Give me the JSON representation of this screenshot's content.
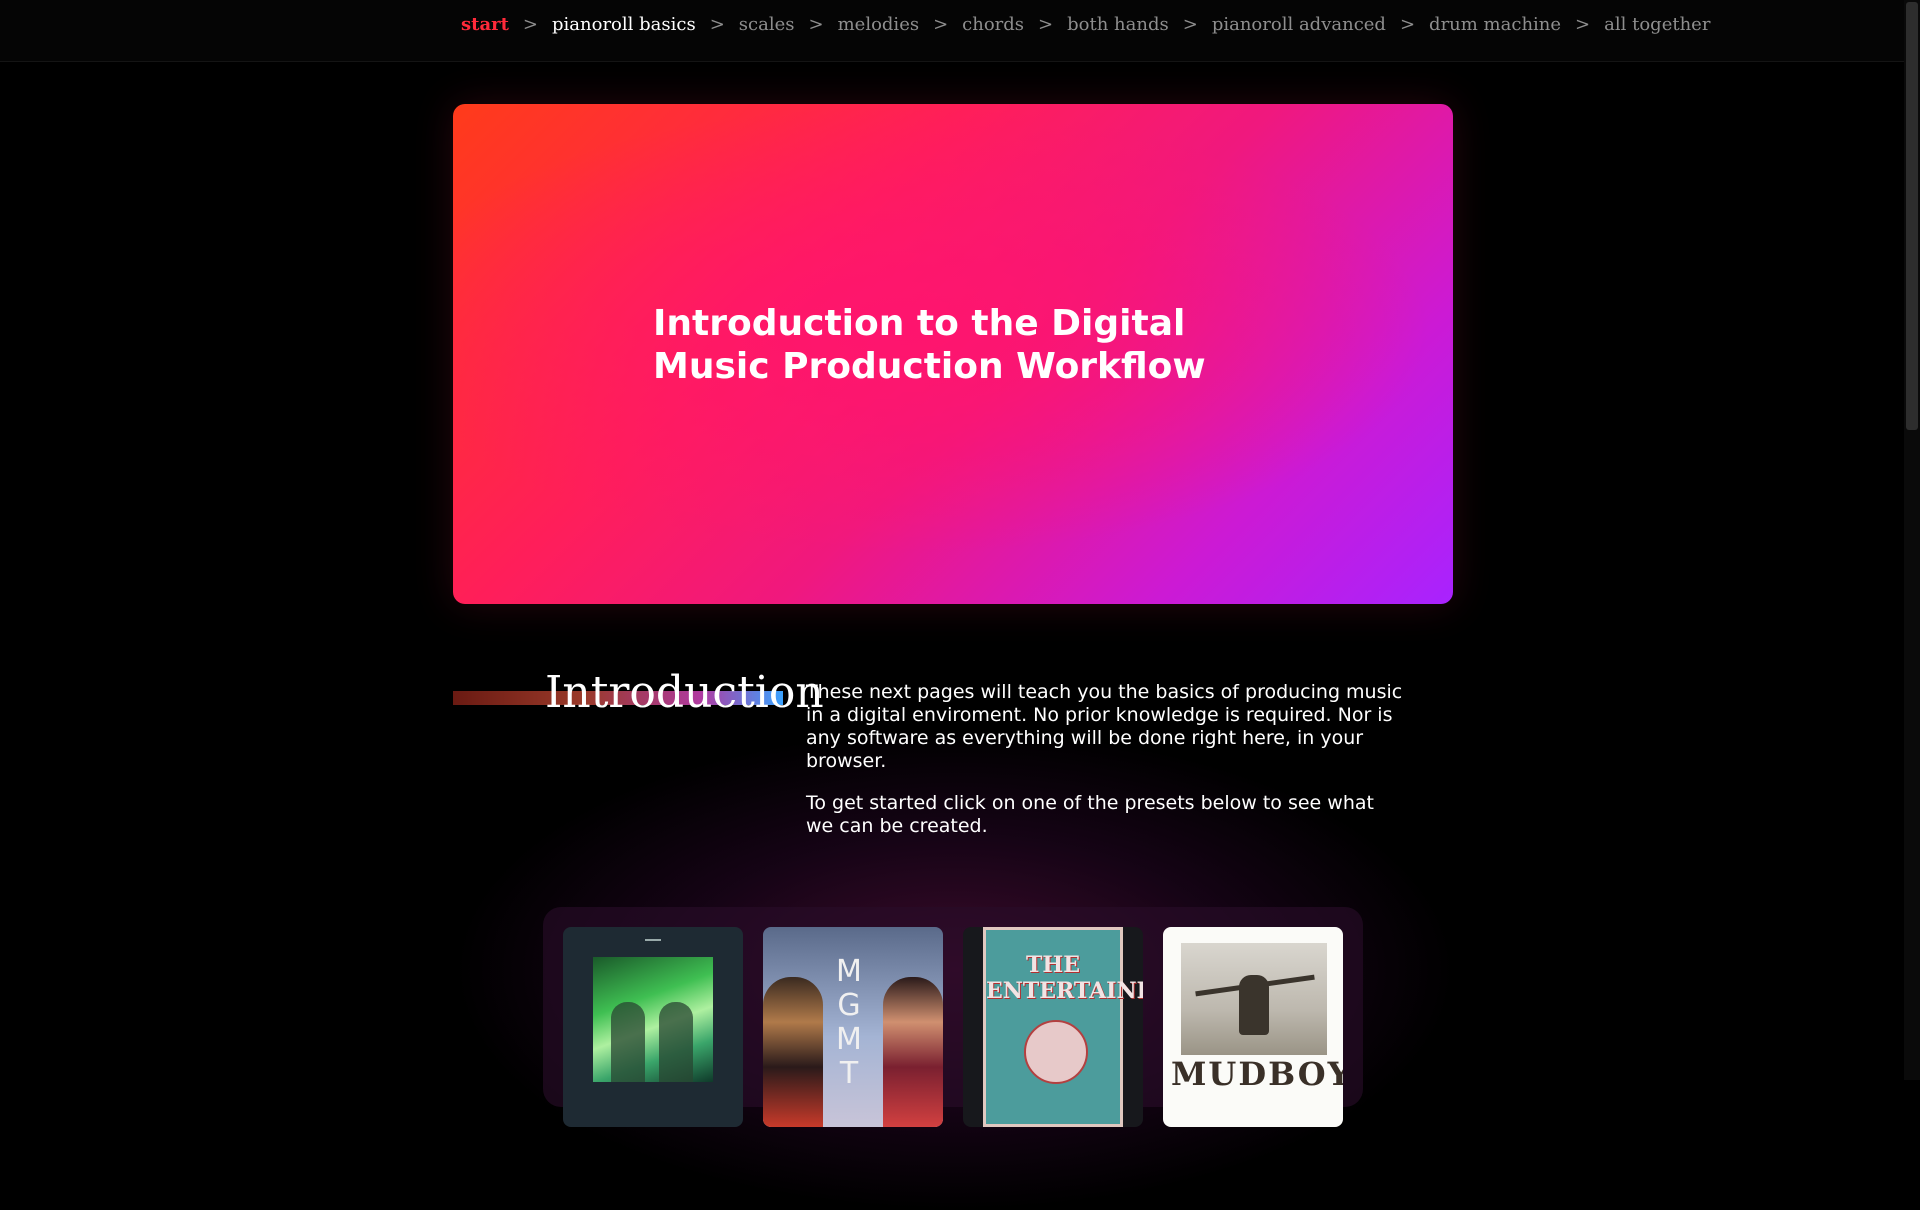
{
  "nav": {
    "items": [
      {
        "label": "start"
      },
      {
        "label": "pianoroll basics"
      },
      {
        "label": "scales"
      },
      {
        "label": "melodies"
      },
      {
        "label": "chords"
      },
      {
        "label": "both hands"
      },
      {
        "label": "pianoroll advanced"
      },
      {
        "label": "drum machine"
      },
      {
        "label": "all together"
      }
    ],
    "separator": ">",
    "active": "start",
    "current": "pianoroll basics"
  },
  "hero": {
    "title": "Introduction to the Digital Music Production Workflow"
  },
  "intro": {
    "heading": "Introduction",
    "paragraphs": [
      "These next pages will teach you the basics of producing music in a digital enviroment. No prior knowledge is required. Nor is any software as everything will be done right here, in your browser.",
      "To get started click on one of the presets below to see what we can be created."
    ]
  },
  "presets": {
    "covers": [
      {
        "title_art": ""
      },
      {
        "title_art": "MGMT"
      },
      {
        "title_art": "THE ENTERTAINER"
      },
      {
        "title_art": "MUDBOY"
      }
    ]
  },
  "colors": {
    "accent": "#ff2a3a",
    "hero_start": "#ff3b1a",
    "hero_end": "#a823ff"
  }
}
